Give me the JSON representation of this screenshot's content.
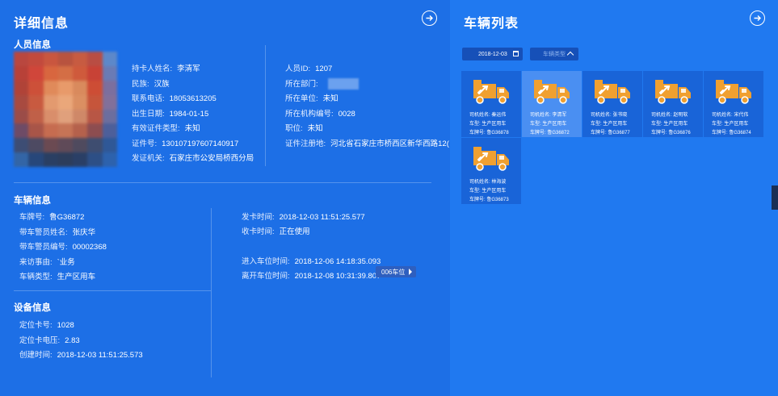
{
  "detail": {
    "title": "详细信息",
    "person_section": "人员信息",
    "person_left": [
      {
        "k": "持卡人姓名:",
        "v": "李清军"
      },
      {
        "k": "民族:",
        "v": "汉族"
      },
      {
        "k": "联系电话:",
        "v": "18053613205"
      },
      {
        "k": "出生日期:",
        "v": "1984-01-15"
      },
      {
        "k": "有效证件类型:",
        "v": "未知"
      },
      {
        "k": "证件号:",
        "v": "130107197607140917"
      },
      {
        "k": "发证机关:",
        "v": "石家庄市公安局桥西分局"
      }
    ],
    "person_right": [
      {
        "k": "人员ID:",
        "v": "1207"
      },
      {
        "k": "所在部门:",
        "v": ""
      },
      {
        "k": "所在单位:",
        "v": "未知"
      },
      {
        "k": "所在机构编号:",
        "v": "0028"
      },
      {
        "k": "职位:",
        "v": "未知"
      },
      {
        "k": "证件注册地:",
        "v": "河北省石家庄市桥西区新华西路12("
      }
    ],
    "vehicle_section": "车辆信息",
    "vehicle_left": [
      {
        "k": "车牌号:",
        "v": "鲁G36872"
      },
      {
        "k": "带车警员姓名:",
        "v": "张庆华"
      },
      {
        "k": "带车警员编号:",
        "v": "00002368"
      },
      {
        "k": "来访事由:",
        "v": "`业务"
      },
      {
        "k": "车辆类型:",
        "v": "生产区用车"
      }
    ],
    "vehicle_right": [
      {
        "k": "发卡时间:",
        "v": "2018-12-03 11:51:25.577"
      },
      {
        "k": "收卡时间:",
        "v": "正在使用"
      },
      {
        "k": "进入车位时间:",
        "v": "2018-12-06 14:18:35.093"
      },
      {
        "k": "离开车位时间:",
        "v": "2018-12-08 10:31:39.807"
      }
    ],
    "slot_button": "006车位",
    "device_section": "设备信息",
    "device": [
      {
        "k": "定位卡号:",
        "v": "1028"
      },
      {
        "k": "定位卡电压:",
        "v": "2.83"
      },
      {
        "k": "创建时间:",
        "v": "2018-12-03 11:51:25.573"
      }
    ]
  },
  "vehicle_list": {
    "title": "车辆列表",
    "date_value": "2018-12-03",
    "type_placeholder": "车辆类型",
    "selected_index": 1,
    "cards": [
      {
        "driver": "司机姓名: 秦运伟",
        "type": "车型: 生产区用车",
        "plate": "车牌号: 鲁G36878"
      },
      {
        "driver": "司机姓名: 李清军",
        "type": "车型: 生产区用车",
        "plate": "车牌号: 鲁G36872"
      },
      {
        "driver": "司机姓名: 张书晓",
        "type": "车型: 生产区用车",
        "plate": "车牌号: 鲁G36877"
      },
      {
        "driver": "司机姓名: 赵明软",
        "type": "车型: 生产区用车",
        "plate": "车牌号: 鲁G36876"
      },
      {
        "driver": "司机姓名: 宋代伟",
        "type": "车型: 生产区用车",
        "plate": "车牌号: 鲁G36874"
      },
      {
        "driver": "司机姓名: 林海波",
        "type": "车型: 生产区用车",
        "plate": "车牌号: 鲁G36873"
      }
    ]
  },
  "colors": {
    "truck_orange": "#f0a030",
    "panel_blue": "#1d6fe6"
  }
}
